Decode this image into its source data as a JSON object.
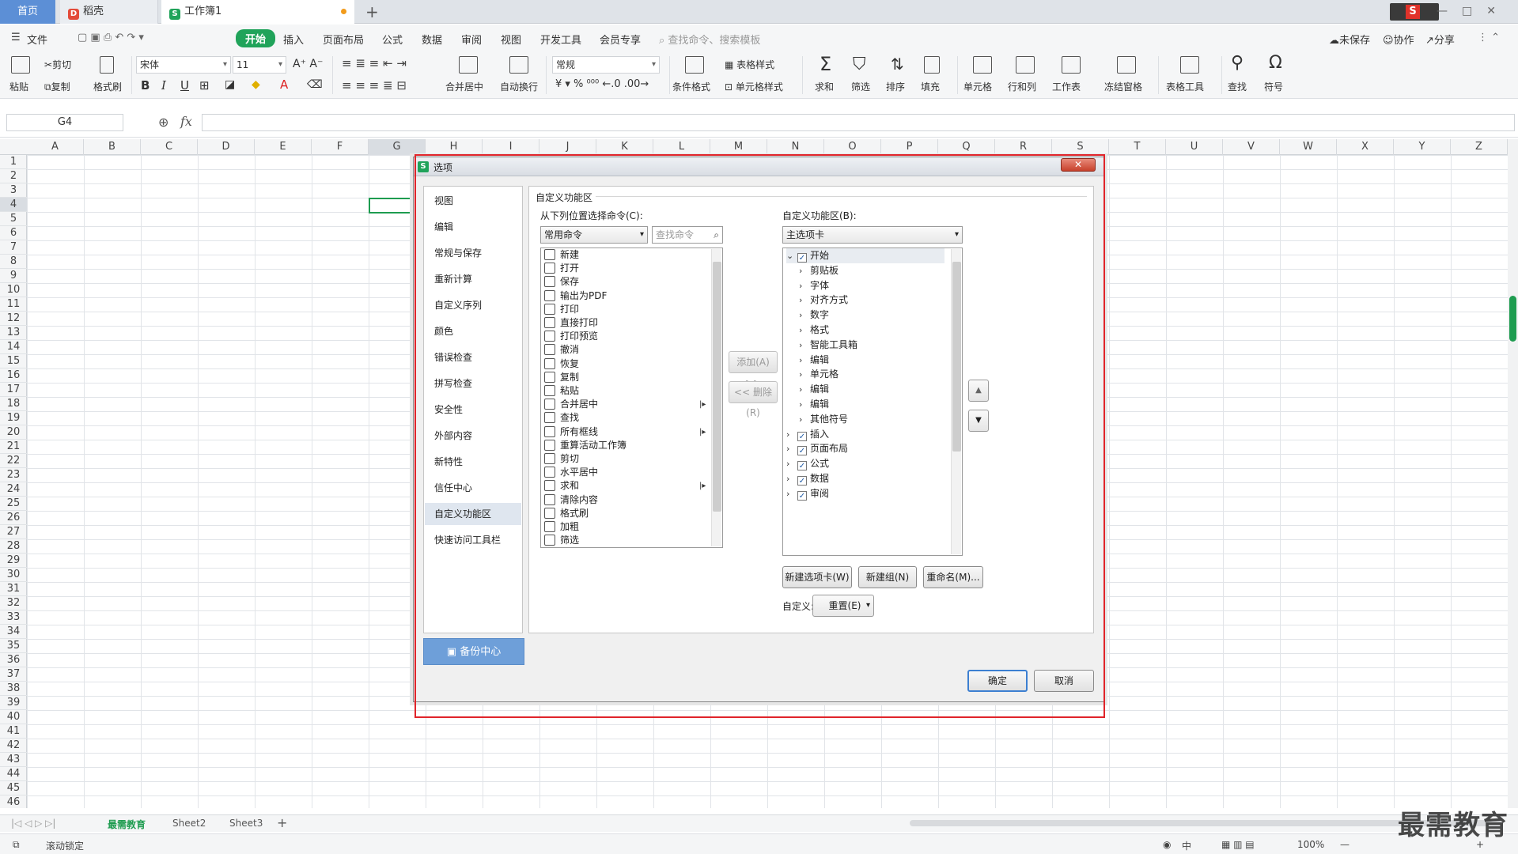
{
  "tabs": {
    "home": "首页",
    "tab1": "稻壳",
    "tab2": "工作簿1",
    "new": "+"
  },
  "menu": {
    "file": "文件",
    "items": [
      "开始",
      "插入",
      "页面布局",
      "公式",
      "数据",
      "审阅",
      "视图",
      "开发工具",
      "会员专享"
    ],
    "search": "查找命令、搜索模板",
    "unsaved": "未保存",
    "collab": "协作",
    "share": "分享"
  },
  "ribbon": {
    "paste": "粘贴",
    "cut": "剪切",
    "copy": "复制",
    "format_painter": "格式刷",
    "font": "宋体",
    "font_size": "11",
    "merge_center": "合并居中",
    "auto_wrap": "自动换行",
    "number_format": "常规",
    "cond_format": "条件格式",
    "table_style": "表格样式",
    "cell_style": "单元格样式",
    "sum": "求和",
    "filter": "筛选",
    "sort": "排序",
    "fill": "填充",
    "cell": "单元格",
    "rowcol": "行和列",
    "worksheet": "工作表",
    "freeze": "冻结窗格",
    "table_tools": "表格工具",
    "find": "查找",
    "symbol": "符号"
  },
  "formula_bar": {
    "cell_ref": "G4",
    "fx": "fx",
    "value": ""
  },
  "grid": {
    "columns": [
      "A",
      "B",
      "C",
      "D",
      "E",
      "F",
      "G",
      "H",
      "I",
      "J",
      "K",
      "L",
      "M",
      "N",
      "O",
      "P",
      "Q",
      "R",
      "S",
      "T",
      "U",
      "V",
      "W",
      "X",
      "Y",
      "Z"
    ],
    "selected_column": "G",
    "selected_row": 4,
    "row_count": 46
  },
  "sheets": {
    "tabs": [
      "最需教育",
      "Sheet2",
      "Sheet3"
    ],
    "active": "最需教育",
    "add": "+"
  },
  "status": {
    "scroll_lock": "滚动锁定",
    "input_mode": "中",
    "zoom": "100%"
  },
  "watermark": "最需教育",
  "dialog": {
    "title": "选项",
    "close": "✕",
    "nav": [
      "视图",
      "编辑",
      "常规与保存",
      "重新计算",
      "自定义序列",
      "颜色",
      "错误检查",
      "拼写检查",
      "安全性",
      "外部内容",
      "新特性",
      "信任中心",
      "自定义功能区",
      "快速访问工具栏"
    ],
    "active_nav": "自定义功能区",
    "backup": "备份中心",
    "section_title": "自定义功能区",
    "left_label": "从下列位置选择命令(C):",
    "left_combo": "常用命令",
    "search_placeholder": "查找命令",
    "commands": [
      {
        "label": "新建",
        "sub": false
      },
      {
        "label": "打开",
        "sub": false
      },
      {
        "label": "保存",
        "sub": false
      },
      {
        "label": "输出为PDF",
        "sub": false
      },
      {
        "label": "打印",
        "sub": false
      },
      {
        "label": "直接打印",
        "sub": false
      },
      {
        "label": "打印预览",
        "sub": false
      },
      {
        "label": "撤消",
        "sub": false
      },
      {
        "label": "恢复",
        "sub": false
      },
      {
        "label": "复制",
        "sub": false
      },
      {
        "label": "粘贴",
        "sub": false
      },
      {
        "label": "合并居中",
        "sub": true
      },
      {
        "label": "查找",
        "sub": false
      },
      {
        "label": "所有框线",
        "sub": true
      },
      {
        "label": "重算活动工作簿",
        "sub": false
      },
      {
        "label": "剪切",
        "sub": false
      },
      {
        "label": "水平居中",
        "sub": false
      },
      {
        "label": "求和",
        "sub": true
      },
      {
        "label": "清除内容",
        "sub": false
      },
      {
        "label": "格式刷",
        "sub": false
      },
      {
        "label": "加粗",
        "sub": false
      },
      {
        "label": "筛选",
        "sub": false
      }
    ],
    "add_btn": "添加(A) >>",
    "remove_btn": "<< 删除(R)",
    "right_label": "自定义功能区(B):",
    "right_combo": "主选项卡",
    "tree": [
      {
        "label": "开始",
        "level": 0,
        "expanded": true,
        "checked": true
      },
      {
        "label": "剪贴板",
        "level": 1
      },
      {
        "label": "字体",
        "level": 1
      },
      {
        "label": "对齐方式",
        "level": 1
      },
      {
        "label": "数字",
        "level": 1
      },
      {
        "label": "格式",
        "level": 1
      },
      {
        "label": "智能工具箱",
        "level": 1
      },
      {
        "label": "编辑",
        "level": 1
      },
      {
        "label": "单元格",
        "level": 1
      },
      {
        "label": "编辑",
        "level": 1
      },
      {
        "label": "编辑",
        "level": 1
      },
      {
        "label": "其他符号",
        "level": 1
      },
      {
        "label": "插入",
        "level": 0,
        "expanded": false,
        "checked": true
      },
      {
        "label": "页面布局",
        "level": 0,
        "expanded": false,
        "checked": true
      },
      {
        "label": "公式",
        "level": 0,
        "expanded": false,
        "checked": true
      },
      {
        "label": "数据",
        "level": 0,
        "expanded": false,
        "checked": true
      },
      {
        "label": "审阅",
        "level": 0,
        "expanded": false,
        "checked": true
      }
    ],
    "new_tab_btn": "新建选项卡(W)",
    "new_group_btn": "新建组(N)",
    "rename_btn": "重命名(M)...",
    "customize_label": "自定义:",
    "reset_btn": "重置(E)",
    "ok": "确定",
    "cancel": "取消"
  },
  "colors": {
    "accent_green": "#1e9c50",
    "highlight_red": "#e0242a",
    "backup_blue": "#6e9fd9"
  }
}
